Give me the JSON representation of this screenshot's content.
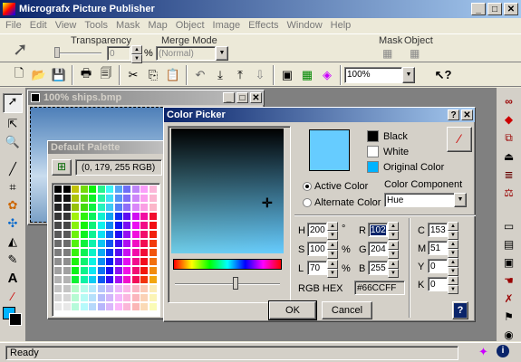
{
  "app": {
    "title": "Micrografx Picture Publisher"
  },
  "menu": [
    "File",
    "Edit",
    "View",
    "Tools",
    "Mask",
    "Map",
    "Object",
    "Image",
    "Effects",
    "Window",
    "Help"
  ],
  "options": {
    "transparency_label": "Transparency",
    "transparency_value": "0",
    "percent": "%",
    "merge_mode_label": "Merge Mode",
    "merge_mode_value": "(Normal)",
    "mask_label": "Mask",
    "object_label": "Object"
  },
  "toolbar": {
    "zoom": "100%"
  },
  "image_window": {
    "title": "100% ships.bmp"
  },
  "palette": {
    "title": "Default Palette",
    "value": "(0, 179, 255 RGB)"
  },
  "picker": {
    "title": "Color Picker",
    "black": "Black",
    "white": "White",
    "original": "Original Color",
    "active": "Active Color",
    "alternate": "Alternate Color",
    "component_label": "Color Component",
    "component_value": "Hue",
    "h_label": "H",
    "h": "200",
    "h_unit": "°",
    "s_label": "S",
    "s": "100",
    "s_unit": "%",
    "l_label": "L",
    "l": "70",
    "l_unit": "%",
    "r_label": "R",
    "r": "102",
    "g_label": "G",
    "g": "204",
    "b_label": "B",
    "b": "255",
    "c_label": "C",
    "c": "153",
    "m_label": "M",
    "m": "51",
    "y_label": "Y",
    "y": "0",
    "k_label": "K",
    "k": "0",
    "hex_label": "RGB HEX",
    "hex": "#66CCFF",
    "ok": "OK",
    "cancel": "Cancel",
    "help": "?"
  },
  "colors": {
    "active": "#66ccff",
    "original": "#00b3ff",
    "title": "#0a246a"
  },
  "status": {
    "text": "Ready"
  }
}
